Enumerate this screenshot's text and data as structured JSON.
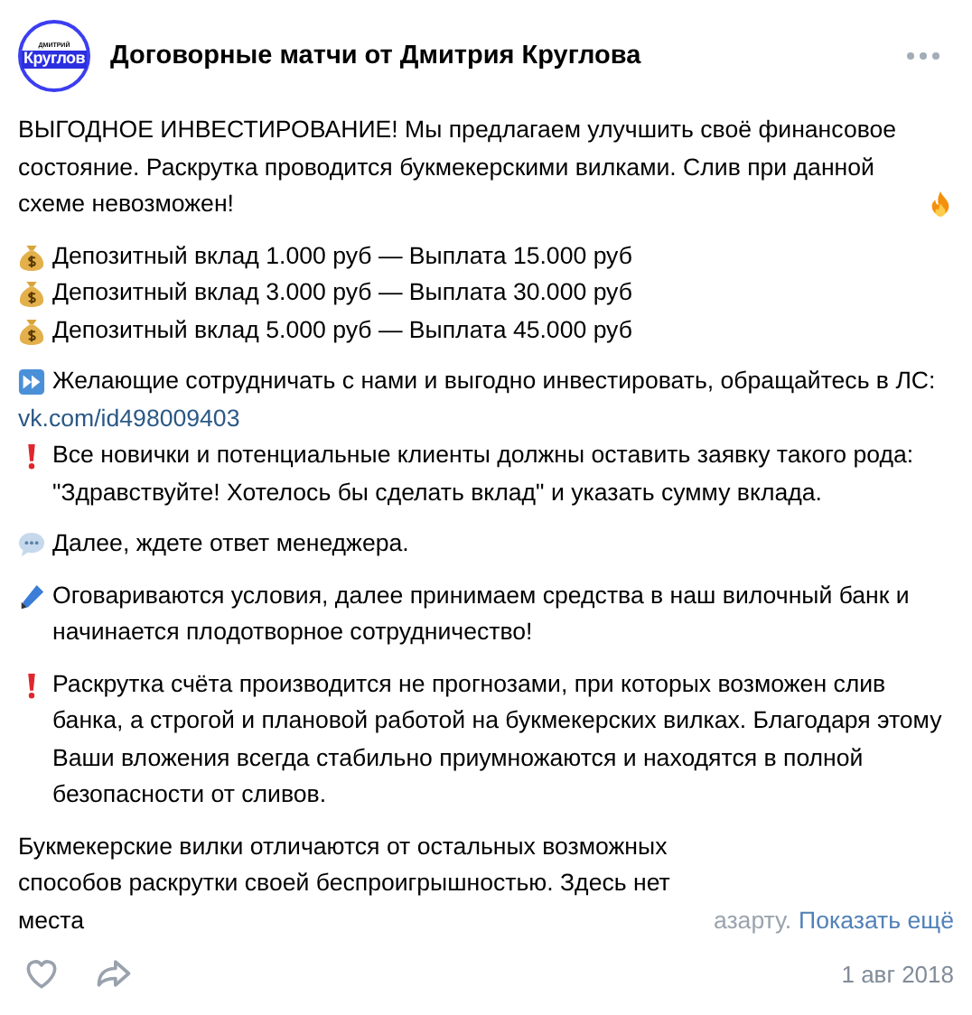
{
  "post": {
    "avatar": {
      "top": "ДМИТРИЙ",
      "main": "Круглов"
    },
    "author": "Договорные матчи от Дмитрия Круглова",
    "paragraphs": [
      {
        "lines": [
          {
            "kind": "plain",
            "text": "ВЫГОДНОЕ ИНВЕСТИРОВАНИЕ! Мы предлагаем улучшить своё финансовое состояние. Раскрутка проводится букмекерскими вилками. Слив при данной схеме невозможен!",
            "ends_with_flame": true
          }
        ]
      },
      {
        "lines": [
          {
            "kind": "deposit",
            "text": "Депозитный вклад 1.000 руб — Выплата 15.000 руб"
          },
          {
            "kind": "deposit",
            "text": "Депозитный вклад 3.000 руб — Выплата 30.000 руб"
          },
          {
            "kind": "deposit",
            "text": "Депозитный вклад 5.000 руб — Выплата 45.000 руб"
          }
        ]
      },
      {
        "lines": [
          {
            "kind": "call",
            "text": "Желающие сотрудничать с нами и выгодно инвестировать, обращайтесь в ЛС:"
          },
          {
            "kind": "link",
            "text": "vk.com/id498009403"
          },
          {
            "kind": "warning",
            "text": "Все новички и потенциальные клиенты должны оставить заявку такого рода: \"Здравствуйте! Хотелось бы сделать вклад\" и указать сумму вклада."
          }
        ]
      },
      {
        "lines": [
          {
            "kind": "chat",
            "text": "Далее, ждете ответ менеджера."
          }
        ]
      },
      {
        "lines": [
          {
            "kind": "note",
            "text": "Оговариваются условия, далее принимаем средства в наш вилочный банк и начинается плодотворное сотрудничество!"
          }
        ]
      },
      {
        "lines": [
          {
            "kind": "warning",
            "text": "Раскрутка счёта производится не прогнозами, при которых возможен слив банка, а строгой и плановой работой на букмекерских вилках. Благодаря этому Ваши вложения всегда стабильно приумножаются и находятся в полной безопасности от сливов."
          }
        ]
      },
      {
        "lines": [
          {
            "kind": "plain",
            "text": "Букмекерские вилки отличаются от остальных возможных способов раскрутки своей беспроигрышностью. Здесь нет места",
            "fade": "азарту.",
            "more": "Показать ещё"
          }
        ]
      }
    ],
    "date": "1 авг 2018"
  }
}
